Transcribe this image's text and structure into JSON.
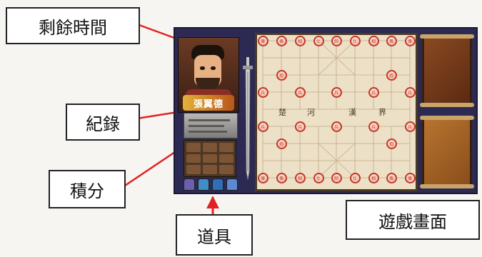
{
  "labels": {
    "remaining_time": "剩餘時間",
    "record": "紀錄",
    "score": "積分",
    "items": "道具",
    "game_screen": "遊戲畫面"
  },
  "game": {
    "portrait_badge": "張翼德",
    "board_top_row": [
      "俥",
      "傌",
      "相",
      "仕",
      "帥",
      "仕",
      "相",
      "傌",
      "俥"
    ],
    "board_bottom_row": [
      "俥",
      "傌",
      "相",
      "仕",
      "帥",
      "仕",
      "相",
      "傌",
      "俥"
    ],
    "cannon": "炮",
    "soldier": "兵",
    "river_text": [
      "楚",
      "河",
      "漢",
      "界"
    ]
  },
  "colors": {
    "game_bg": "#2c2a52",
    "board": "#ece0c6",
    "piece_red": "#c0392b",
    "arrow_red": "#e02222"
  }
}
